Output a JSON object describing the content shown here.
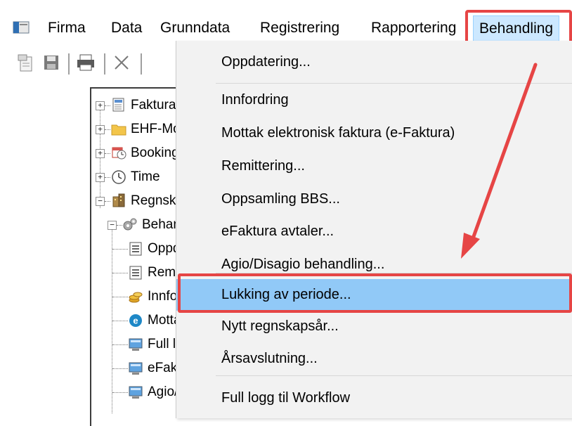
{
  "menubar": {
    "items": [
      {
        "label": "Firma"
      },
      {
        "label": "Data"
      },
      {
        "label": "Grunndata"
      },
      {
        "label": "Registrering"
      },
      {
        "label": "Rapportering"
      },
      {
        "label": "Behandling"
      }
    ]
  },
  "toolbar": {
    "icons": [
      "new-document-icon",
      "save-icon",
      "print-icon",
      "delete-icon"
    ]
  },
  "tree": {
    "items": [
      {
        "label": "Faktura",
        "icon": "invoice-icon"
      },
      {
        "label": "EHF-Monitor",
        "icon": "folder-icon"
      },
      {
        "label": "Booking",
        "icon": "calendar-clock-icon"
      },
      {
        "label": "Time",
        "icon": "clock-icon"
      },
      {
        "label": "Regnskap",
        "icon": "building-icon"
      },
      {
        "label": "Behandlin",
        "icon": "gears-icon"
      },
      {
        "label": "Oppda",
        "icon": "document-list-icon"
      },
      {
        "label": "Remitt",
        "icon": "document-list-icon"
      },
      {
        "label": "Innfor",
        "icon": "coins-icon"
      },
      {
        "label": "Motta",
        "icon": "e-icon"
      },
      {
        "label": "Full lo",
        "icon": "monitor-icon"
      },
      {
        "label": "eFaktu",
        "icon": "monitor-icon"
      },
      {
        "label": "Agio/D",
        "icon": "monitor-icon"
      }
    ]
  },
  "dropdown": {
    "items": [
      {
        "label": "Oppdatering..."
      },
      {
        "label": "Innfordring"
      },
      {
        "label": "Mottak elektronisk faktura (e-Faktura)"
      },
      {
        "label": "Remittering..."
      },
      {
        "label": "Oppsamling BBS..."
      },
      {
        "label": "eFaktura avtaler..."
      },
      {
        "label": "Agio/Disagio behandling..."
      },
      {
        "label": "Lukking av periode..."
      },
      {
        "label": "Nytt regnskapsår..."
      },
      {
        "label": "Årsavslutning..."
      },
      {
        "label": "Full logg til Workflow"
      }
    ],
    "highlighted_index": 7,
    "highlight_color": "#91c9f7"
  },
  "annotation": {
    "color": "#e64545"
  }
}
